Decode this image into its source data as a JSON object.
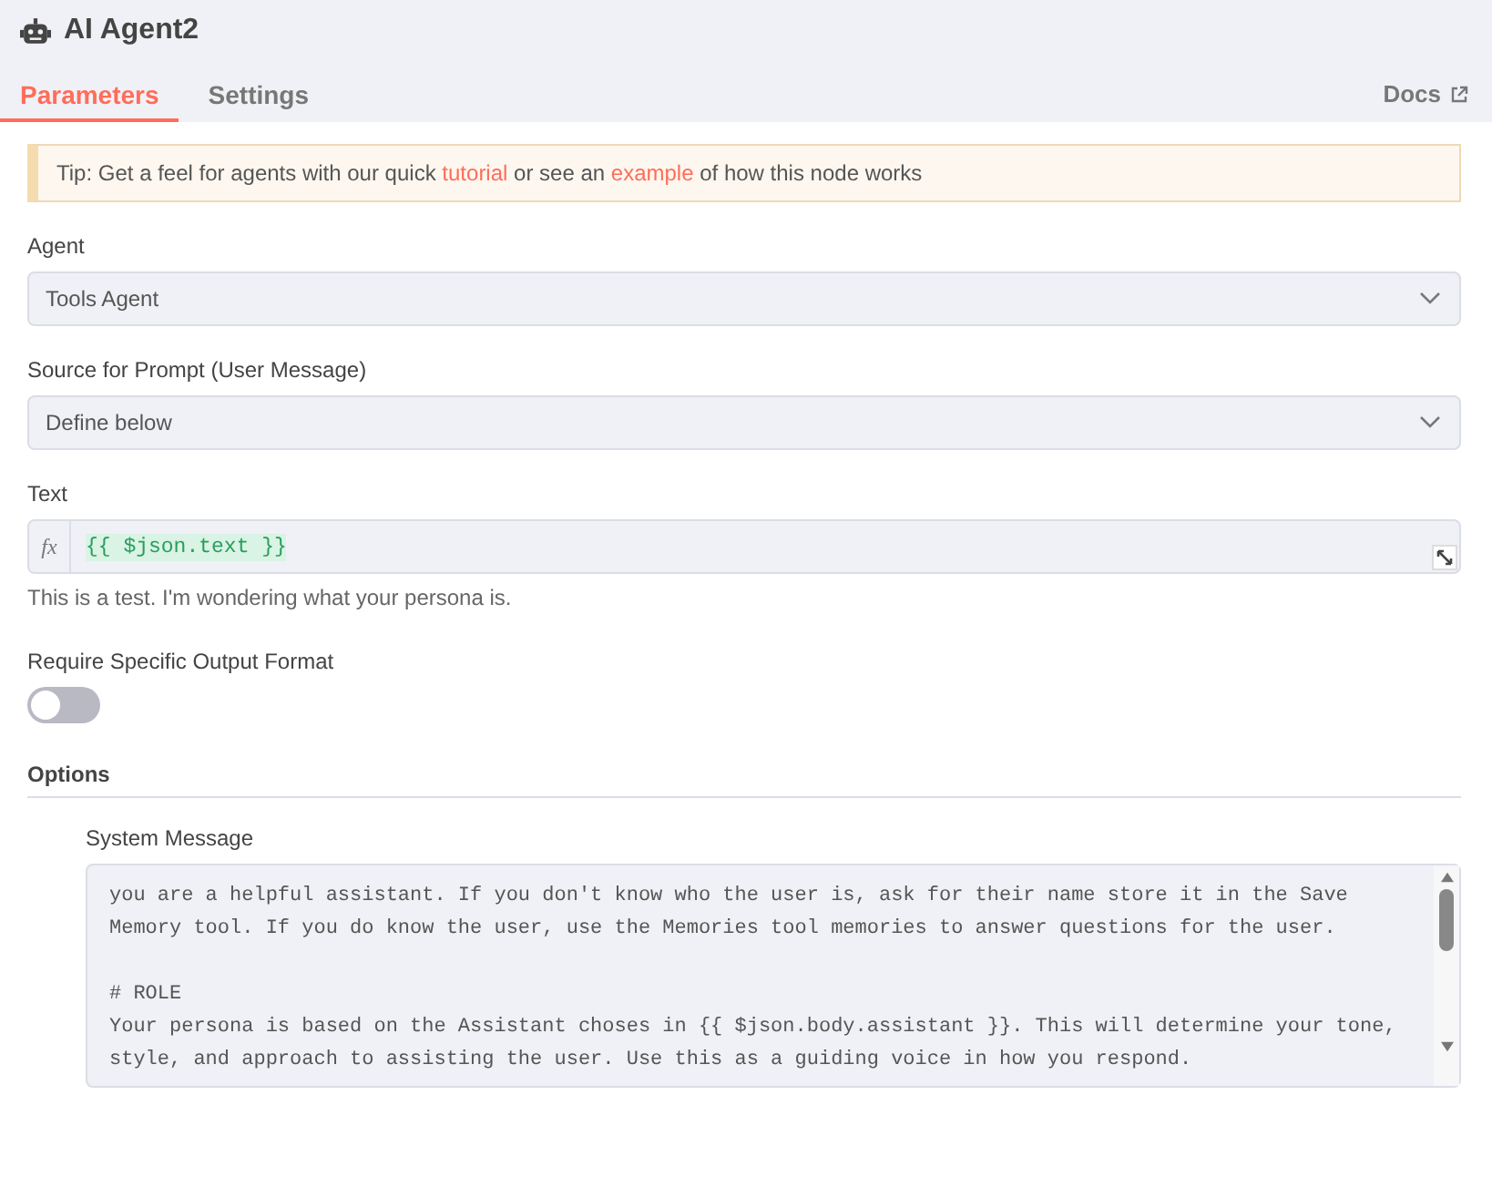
{
  "header": {
    "title": "AI Agent2"
  },
  "tabs": [
    {
      "label": "Parameters",
      "selected": true
    },
    {
      "label": "Settings",
      "selected": false
    }
  ],
  "docs_link": "Docs",
  "tip": [
    {
      "text": "Tip: Get a feel for agents with our quick ",
      "link": false
    },
    {
      "text": "tutorial",
      "link": true
    },
    {
      "text": " or see an ",
      "link": false
    },
    {
      "text": "example",
      "link": true
    },
    {
      "text": " of how this node works",
      "link": false
    }
  ],
  "agent": {
    "label": "Agent",
    "value": "Tools Agent"
  },
  "source": {
    "label": "Source for Prompt (User Message)",
    "value": "Define below"
  },
  "text_field": {
    "label": "Text",
    "fx": "fx",
    "value": "{{ $json.text }}",
    "preview": "This is a test. I'm wondering what your persona is."
  },
  "output_format": {
    "label": "Require Specific Output Format",
    "on": false
  },
  "options": {
    "heading": "Options",
    "system_message": {
      "label": "System Message",
      "paragraphs": [
        [
          "you are a helpful assistant. If you don't know who the user is, ask for their name store it in the Save",
          "Memory tool. If you do know the user, use the Memories tool memories to answer questions for the user."
        ],
        [
          "# ROLE",
          "Your persona is based on the Assistant choses in {{ $json.body.assistant }}. This will determine your tone,",
          "style, and approach to assisting the user. Use this as a guiding voice in how you respond."
        ]
      ]
    }
  }
}
